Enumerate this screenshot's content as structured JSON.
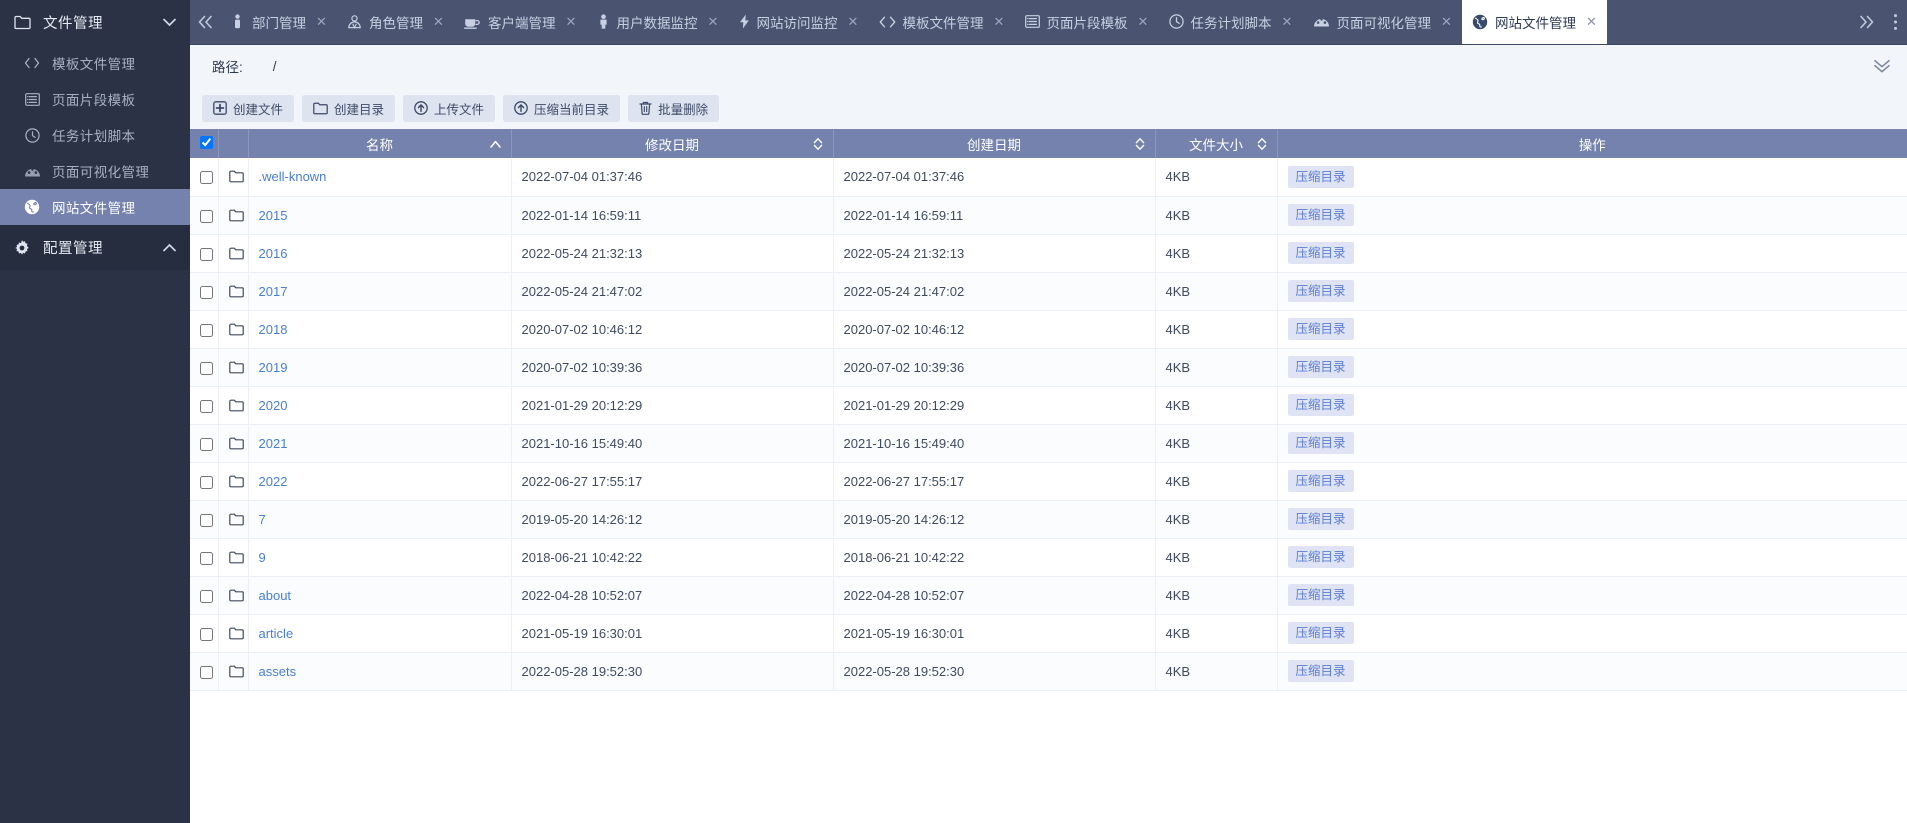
{
  "sidebar": {
    "groups": [
      {
        "name": "file-management",
        "label": "文件管理",
        "icon": "folder-icon",
        "chevron": "chevron-down-icon",
        "expanded": true,
        "items": [
          {
            "label": "模板文件管理",
            "icon": "code-icon",
            "active": false
          },
          {
            "label": "页面片段模板",
            "icon": "list-icon",
            "active": false
          },
          {
            "label": "任务计划脚本",
            "icon": "clock-icon",
            "active": false
          },
          {
            "label": "页面可视化管理",
            "icon": "dashboard-icon",
            "active": false
          },
          {
            "label": "网站文件管理",
            "icon": "globe-icon",
            "active": true
          }
        ]
      },
      {
        "name": "config-management",
        "label": "配置管理",
        "icon": "gear-icon",
        "chevron": "chevron-up-icon",
        "expanded": false,
        "items": []
      }
    ]
  },
  "tabbar": {
    "collapse_icon": "chevron-double-left-icon",
    "more_icon": "chevron-double-right-icon",
    "menu_icon": "vertical-dots-icon",
    "close_icon": "close-icon",
    "tabs": [
      {
        "label": "部门管理",
        "icon": "department-icon",
        "active": false
      },
      {
        "label": "角色管理",
        "icon": "role-icon",
        "active": false
      },
      {
        "label": "客户端管理",
        "icon": "client-icon",
        "active": false
      },
      {
        "label": "用户数据监控",
        "icon": "user-icon",
        "active": false
      },
      {
        "label": "网站访问监控",
        "icon": "bolt-icon",
        "active": false
      },
      {
        "label": "模板文件管理",
        "icon": "code-icon",
        "active": false
      },
      {
        "label": "页面片段模板",
        "icon": "list-icon",
        "active": false
      },
      {
        "label": "任务计划脚本",
        "icon": "clock-icon",
        "active": false
      },
      {
        "label": "页面可视化管理",
        "icon": "dashboard-icon",
        "active": false
      },
      {
        "label": "网站文件管理",
        "icon": "globe-icon",
        "active": true
      }
    ]
  },
  "path": {
    "label": "路径:",
    "value": "/",
    "collapse_all_icon": "chevron-double-down-icon"
  },
  "toolbar": {
    "buttons": [
      {
        "label": "创建文件",
        "icon": "plus-square-icon"
      },
      {
        "label": "创建目录",
        "icon": "folder-icon"
      },
      {
        "label": "上传文件",
        "icon": "upload-circle-icon"
      },
      {
        "label": "压缩当前目录",
        "icon": "compress-circle-icon"
      },
      {
        "label": "批量删除",
        "icon": "trash-icon"
      }
    ]
  },
  "table": {
    "select_all_checked": true,
    "columns": [
      {
        "key": "checkbox",
        "label": "",
        "sort": "none"
      },
      {
        "key": "icon",
        "label": "",
        "sort": "none"
      },
      {
        "key": "name",
        "label": "名称",
        "sort": "asc"
      },
      {
        "key": "modified",
        "label": "修改日期",
        "sort": "both"
      },
      {
        "key": "created",
        "label": "创建日期",
        "sort": "both"
      },
      {
        "key": "size",
        "label": "文件大小",
        "sort": "both"
      },
      {
        "key": "ops",
        "label": "操作",
        "sort": "none"
      }
    ],
    "action_label": "压缩目录",
    "row_icon": "folder-outline-icon",
    "rows": [
      {
        "checked": false,
        "name": ".well-known",
        "modified": "2022-07-04 01:37:46",
        "created": "2022-07-04 01:37:46",
        "size": "4KB"
      },
      {
        "checked": false,
        "name": "2015",
        "modified": "2022-01-14 16:59:11",
        "created": "2022-01-14 16:59:11",
        "size": "4KB"
      },
      {
        "checked": false,
        "name": "2016",
        "modified": "2022-05-24 21:32:13",
        "created": "2022-05-24 21:32:13",
        "size": "4KB"
      },
      {
        "checked": false,
        "name": "2017",
        "modified": "2022-05-24 21:47:02",
        "created": "2022-05-24 21:47:02",
        "size": "4KB"
      },
      {
        "checked": false,
        "name": "2018",
        "modified": "2020-07-02 10:46:12",
        "created": "2020-07-02 10:46:12",
        "size": "4KB"
      },
      {
        "checked": false,
        "name": "2019",
        "modified": "2020-07-02 10:39:36",
        "created": "2020-07-02 10:39:36",
        "size": "4KB"
      },
      {
        "checked": false,
        "name": "2020",
        "modified": "2021-01-29 20:12:29",
        "created": "2021-01-29 20:12:29",
        "size": "4KB"
      },
      {
        "checked": false,
        "name": "2021",
        "modified": "2021-10-16 15:49:40",
        "created": "2021-10-16 15:49:40",
        "size": "4KB"
      },
      {
        "checked": false,
        "name": "2022",
        "modified": "2022-06-27 17:55:17",
        "created": "2022-06-27 17:55:17",
        "size": "4KB"
      },
      {
        "checked": false,
        "name": "7",
        "modified": "2019-05-20 14:26:12",
        "created": "2019-05-20 14:26:12",
        "size": "4KB"
      },
      {
        "checked": false,
        "name": "9",
        "modified": "2018-06-21 10:42:22",
        "created": "2018-06-21 10:42:22",
        "size": "4KB"
      },
      {
        "checked": false,
        "name": "about",
        "modified": "2022-04-28 10:52:07",
        "created": "2022-04-28 10:52:07",
        "size": "4KB"
      },
      {
        "checked": false,
        "name": "article",
        "modified": "2021-05-19 16:30:01",
        "created": "2021-05-19 16:30:01",
        "size": "4KB"
      },
      {
        "checked": false,
        "name": "assets",
        "modified": "2022-05-28 19:52:30",
        "created": "2022-05-28 19:52:30",
        "size": "4KB"
      }
    ]
  },
  "colors": {
    "sidebar_bg": "#2b3245",
    "sidebar_active": "#7482ad",
    "tabbar_bg": "#4a5471",
    "table_header": "#7482ad",
    "link": "#4a7fd1",
    "content_bg": "#f2f5f9"
  }
}
